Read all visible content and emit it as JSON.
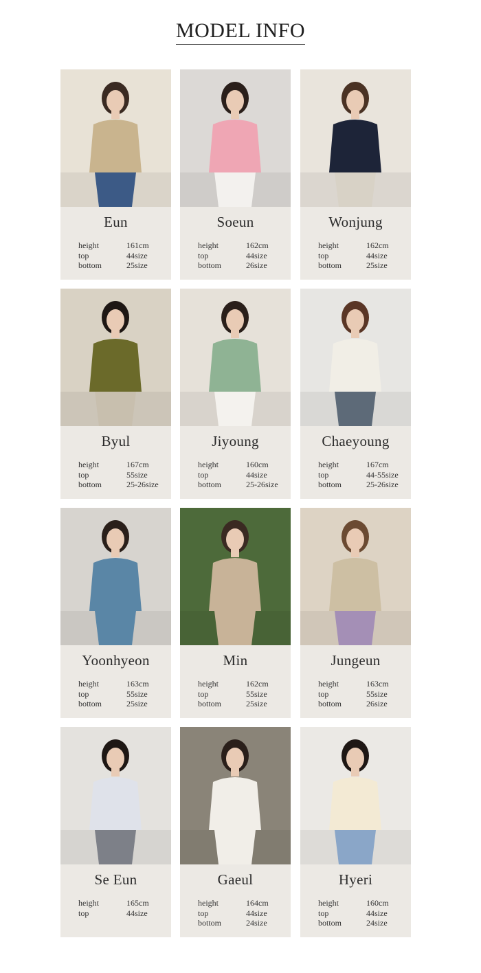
{
  "page": {
    "title": "MODEL INFO"
  },
  "labels": {
    "height": "height",
    "top": "top",
    "bottom": "bottom"
  },
  "models": [
    {
      "name": "Eun",
      "height": "161cm",
      "top": "44size",
      "bottom": "25size",
      "colors": {
        "bg": "#e8e2d6",
        "garment": "#c9b48e",
        "pants": "#3c5a86",
        "hair": "#3a2a22"
      }
    },
    {
      "name": "Soeun",
      "height": "162cm",
      "top": "44size",
      "bottom": "26size",
      "colors": {
        "bg": "#dcd9d6",
        "garment": "#efa6b4",
        "pants": "#f3f1ee",
        "hair": "#2a1f1a"
      }
    },
    {
      "name": "Wonjung",
      "height": "162cm",
      "top": "44size",
      "bottom": "25size",
      "colors": {
        "bg": "#e9e4dc",
        "garment": "#1d2438",
        "pants": "#d8d2c6",
        "hair": "#4a3224"
      }
    },
    {
      "name": "Byul",
      "height": "167cm",
      "top": "55size",
      "bottom": "25-26size",
      "colors": {
        "bg": "#d9d2c4",
        "garment": "#6b6a2a",
        "pants": "#c8bfae",
        "hair": "#1e1714"
      }
    },
    {
      "name": "Jiyoung",
      "height": "160cm",
      "top": "44size",
      "bottom": "25-26size",
      "colors": {
        "bg": "#e6e1d9",
        "garment": "#8fb394",
        "pants": "#f4f2ee",
        "hair": "#2a1f1a"
      }
    },
    {
      "name": "Chaeyoung",
      "height": "167cm",
      "top": "44-55size",
      "bottom": "25-26size",
      "colors": {
        "bg": "#e7e6e3",
        "garment": "#f1eee6",
        "pants": "#5d6a78",
        "hair": "#5a3626"
      }
    },
    {
      "name": "Yoonhyeon",
      "height": "163cm",
      "top": "55size",
      "bottom": "25size",
      "colors": {
        "bg": "#d7d4cf",
        "garment": "#5a86a6",
        "pants": "#5a86a6",
        "hair": "#2a1f1a"
      }
    },
    {
      "name": "Min",
      "height": "162cm",
      "top": "55size",
      "bottom": "25size",
      "colors": {
        "bg": "#4d6a3a",
        "garment": "#c8b398",
        "pants": "#c8b398",
        "hair": "#3a2a22"
      }
    },
    {
      "name": "Jungeun",
      "height": "163cm",
      "top": "55size",
      "bottom": "26size",
      "colors": {
        "bg": "#ddd3c4",
        "garment": "#cdbfa3",
        "pants": "#a48fb6",
        "hair": "#6b4a32"
      }
    },
    {
      "name": "Se Eun",
      "height": "165cm",
      "top": "44size",
      "bottom": "",
      "colors": {
        "bg": "#e4e2de",
        "garment": "#dfe2ea",
        "pants": "#7d8088",
        "hair": "#1e1714"
      }
    },
    {
      "name": "Gaeul",
      "height": "164cm",
      "top": "44size",
      "bottom": "24size",
      "colors": {
        "bg": "#8a8478",
        "garment": "#f1eee8",
        "pants": "#f1eee8",
        "hair": "#2a1f1a"
      }
    },
    {
      "name": "Hyeri",
      "height": "160cm",
      "top": "44size",
      "bottom": "24size",
      "colors": {
        "bg": "#ebe9e5",
        "garment": "#f3ead4",
        "pants": "#8aa6c8",
        "hair": "#1e1714"
      }
    }
  ]
}
